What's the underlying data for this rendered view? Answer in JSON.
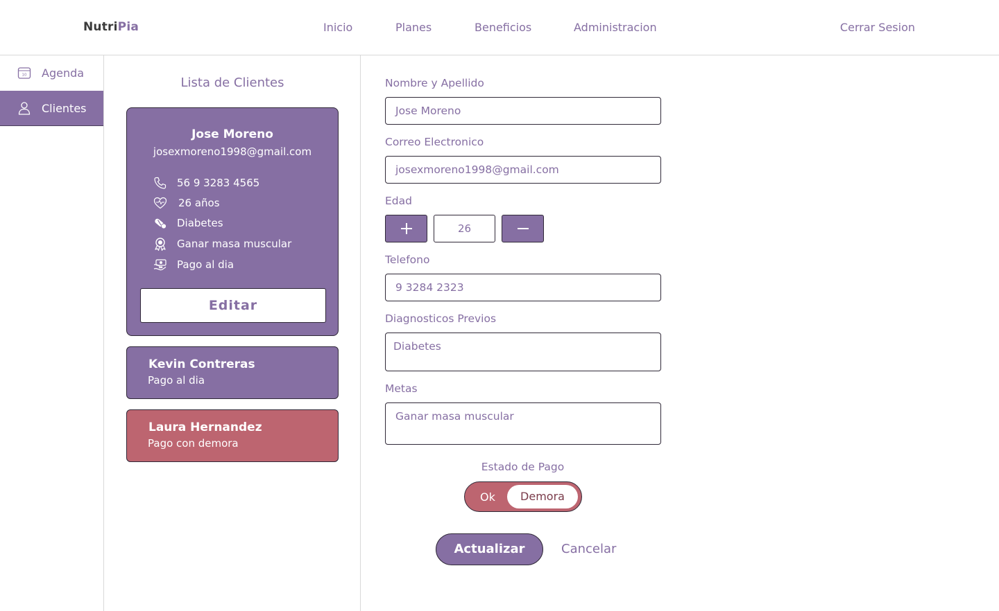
{
  "brand": {
    "part1": "Nutri",
    "part2": "Pia"
  },
  "nav": {
    "links": [
      "Inicio",
      "Planes",
      "Beneficios",
      "Administracion"
    ],
    "logout": "Cerrar Sesion"
  },
  "sidebar": {
    "items": [
      {
        "label": "Agenda",
        "icon": "calendar-icon",
        "active": false
      },
      {
        "label": "Clientes",
        "icon": "user-icon",
        "active": true
      }
    ]
  },
  "client_list": {
    "title": "Lista de Clientes",
    "selected": {
      "name": "Jose Moreno",
      "email": "josexmoreno1998@gmail.com",
      "phone": "56 9 3283 4565",
      "age": "26 años",
      "diagnosis": "Diabetes",
      "goal": "Ganar masa muscular",
      "payment": "Pago al dia",
      "edit_label": "Editar"
    },
    "others": [
      {
        "name": "Kevin Contreras",
        "status": "Pago al dia",
        "status_color": "#866fa3"
      },
      {
        "name": "Laura Hernandez",
        "status": "Pago con demora",
        "status_color": "#bd6570"
      }
    ]
  },
  "form": {
    "name_label": "Nombre y Apellido",
    "name_value": "Jose Moreno",
    "email_label": "Correo Electronico",
    "email_value": "josexmoreno1998@gmail.com",
    "age_label": "Edad",
    "age_value": "26",
    "phone_label": "Telefono",
    "phone_value": "9 3284 2323",
    "diag_label": "Diagnosticos Previos",
    "diag_value": "Diabetes",
    "goals_label": "Metas",
    "goals_value": "Ganar masa muscular",
    "payment_label": "Estado de Pago",
    "payment_options": [
      "Ok",
      "Demora"
    ],
    "payment_selected": "Demora",
    "update_label": "Actualizar",
    "cancel_label": "Cancelar"
  },
  "colors": {
    "primary": "#866fa3",
    "late": "#bd6570",
    "border": "#2f2837"
  }
}
